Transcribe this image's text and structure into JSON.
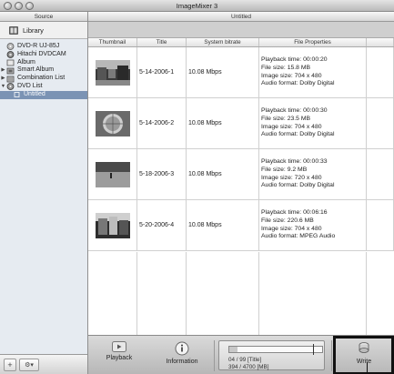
{
  "window": {
    "title": "ImageMixer 3"
  },
  "sidebar": {
    "header": "Source",
    "library_label": "Library",
    "items": [
      {
        "label": "DVD-R  UJ-85J",
        "icon": "disc-icon",
        "arrow": ""
      },
      {
        "label": "Hitachi DVDCAM",
        "icon": "camera-icon",
        "arrow": ""
      },
      {
        "label": "Album",
        "icon": "album-icon",
        "arrow": ""
      },
      {
        "label": "Smart Album",
        "icon": "smart-album-icon",
        "arrow": "▶"
      },
      {
        "label": "Combination List",
        "icon": "list-icon",
        "arrow": "▶"
      },
      {
        "label": "DVD List",
        "icon": "dvd-icon",
        "arrow": "▼"
      },
      {
        "label": "Untitled",
        "icon": "item-icon",
        "arrow": ""
      }
    ],
    "add_label": "+",
    "gear_label": "⚙▾"
  },
  "main": {
    "header": "Untitled",
    "columns": [
      "Thumbnail",
      "Title",
      "System bitrate",
      "File Properties"
    ],
    "rows": [
      {
        "title": "5-14-2006-1",
        "bitrate": "10.08 Mbps",
        "props": [
          "Playback time: 00:00:20",
          "File size: 15.8 MB",
          "Image size: 704 x 480",
          "Audio format: Dolby Digital"
        ],
        "thumb": "street-scene"
      },
      {
        "title": "5-14-2006-2",
        "bitrate": "10.08 Mbps",
        "props": [
          "Playback time: 00:00:30",
          "File size: 23.5 MB",
          "Image size: 704 x 480",
          "Audio format: Dolby Digital"
        ],
        "thumb": "round-object"
      },
      {
        "title": "5-18-2006-3",
        "bitrate": "10.08 Mbps",
        "props": [
          "Playback time: 00:00:33",
          "File size: 9.2 MB",
          "Image size: 720 x 480",
          "Audio format: Dolby Digital"
        ],
        "thumb": "field-scene"
      },
      {
        "title": "5-20-2006-4",
        "bitrate": "10.08 Mbps",
        "props": [
          "Playback time: 00:06:16",
          "File size: 220.6 MB",
          "Image size: 704 x 480",
          "Audio format: MPEG Audio"
        ],
        "thumb": "building-scene"
      }
    ]
  },
  "toolbar": {
    "playback_label": "Playback",
    "information_label": "Information",
    "write_label": "Write",
    "gauge": {
      "line1": "04 / 99 [Title]",
      "line2": "394 / 4700 [MB]",
      "fill_fraction": 0.084
    }
  }
}
